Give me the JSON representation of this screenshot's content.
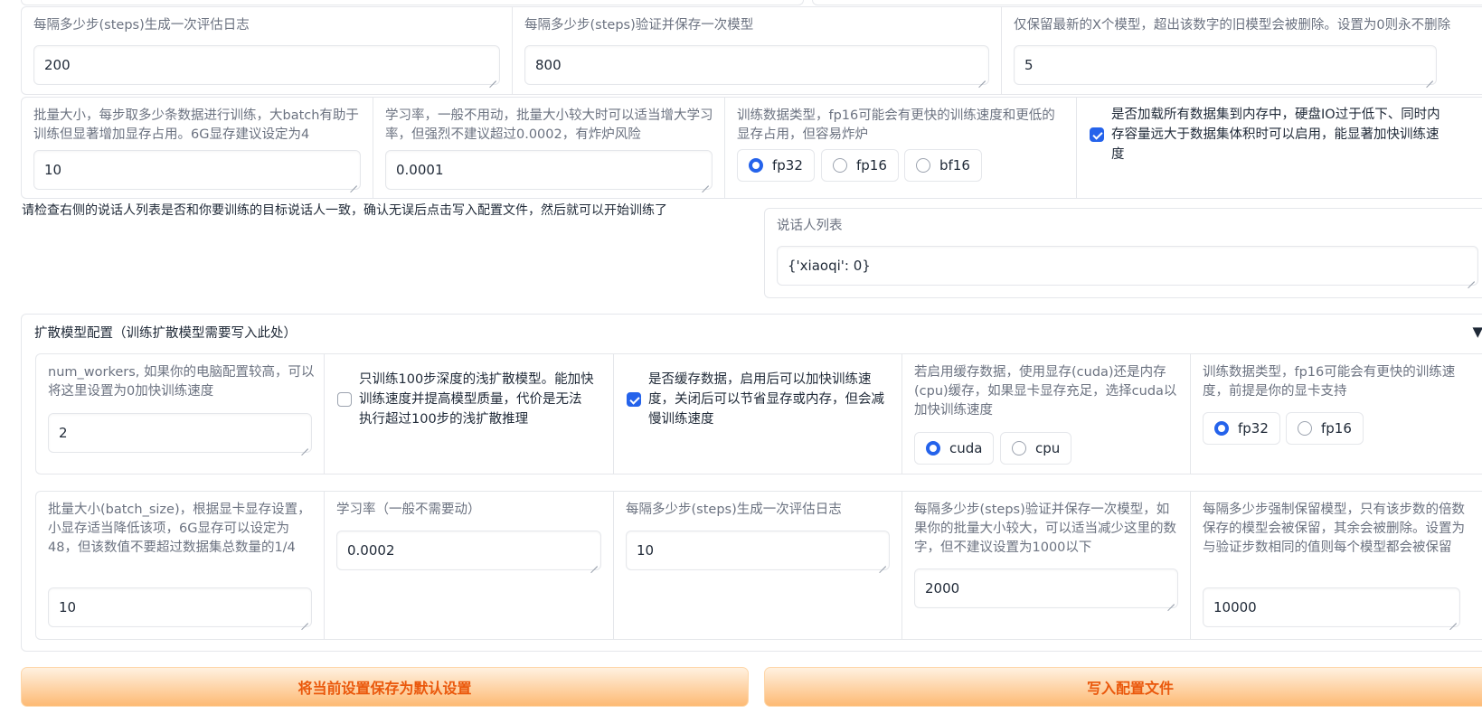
{
  "top_row": [
    {
      "label": "每隔多少步(steps)生成一次评估日志",
      "value": "200"
    },
    {
      "label": "每隔多少步(steps)验证并保存一次模型",
      "value": "800"
    },
    {
      "label": "仅保留最新的X个模型，超出该数字的旧模型会被删除。设置为0则永不删除",
      "value": "5"
    }
  ],
  "second_row": {
    "batch": {
      "label": "批量大小，每步取多少条数据进行训练，大batch有助于训练但显著增加显存占用。6G显存建议设定为4",
      "value": "10"
    },
    "lr": {
      "label": "学习率，一般不用动，批量大小较大时可以适当增大学习率，但强烈不建议超过0.0002，有炸炉风险",
      "value": "0.0001"
    },
    "dtype": {
      "label": "训练数据类型，fp16可能会有更快的训练速度和更低的显存占用，但容易炸炉",
      "options": [
        "fp32",
        "fp16",
        "bf16"
      ],
      "selected": "fp32"
    },
    "load_all": {
      "label": "是否加载所有数据集到内存中，硬盘IO过于低下、同时内存容量远大于数据集体积时可以启用，能显著加快训练速度",
      "checked": true
    }
  },
  "notice": "请检查右侧的说话人列表是否和你要训练的目标说话人一致，确认无误后点击写入配置文件，然后就可以开始训练了",
  "speakers": {
    "label": "说话人列表",
    "value": "{'xiaoqi': 0}"
  },
  "diffusion": {
    "title": "扩散模型配置（训练扩散模型需要写入此处）",
    "toggle_icon": "▼",
    "row1": {
      "workers": {
        "label": "num_workers, 如果你的电脑配置较高，可以将这里设置为0加快训练速度",
        "value": "2"
      },
      "shallow": {
        "label": "只训练100步深度的浅扩散模型。能加快训练速度并提高模型质量，代价是无法执行超过100步的浅扩散推理",
        "checked": false
      },
      "cache": {
        "label": "是否缓存数据，启用后可以加快训练速度，关闭后可以节省显存或内存，但会减慢训练速度",
        "checked": true
      },
      "cache_device": {
        "label": "若启用缓存数据，使用显存(cuda)还是内存(cpu)缓存，如果显卡显存充足，选择cuda以加快训练速度",
        "options": [
          "cuda",
          "cpu"
        ],
        "selected": "cuda"
      },
      "dtype": {
        "label": "训练数据类型，fp16可能会有更快的训练速度，前提是你的显卡支持",
        "options": [
          "fp32",
          "fp16"
        ],
        "selected": "fp32"
      }
    },
    "row2": {
      "batch": {
        "label": "批量大小(batch_size)，根据显卡显存设置，小显存适当降低该项，6G显存可以设定为48，但该数值不要超过数据集总数量的1/4",
        "value": "10"
      },
      "lr": {
        "label": "学习率（一般不需要动）",
        "value": "0.0002"
      },
      "log": {
        "label": "每隔多少步(steps)生成一次评估日志",
        "value": "10"
      },
      "save": {
        "label": "每隔多少步(steps)验证并保存一次模型，如果你的批量大小较大，可以适当减少这里的数字，但不建议设置为1000以下",
        "value": "2000"
      },
      "keep": {
        "label": "每隔多少步强制保留模型，只有该步数的倍数保存的模型会被保留，其余会被删除。设置为与验证步数相同的值则每个模型都会被保留",
        "value": "10000"
      }
    }
  },
  "buttons": {
    "save_default": "将当前设置保存为默认设置",
    "write_config": "写入配置文件"
  }
}
